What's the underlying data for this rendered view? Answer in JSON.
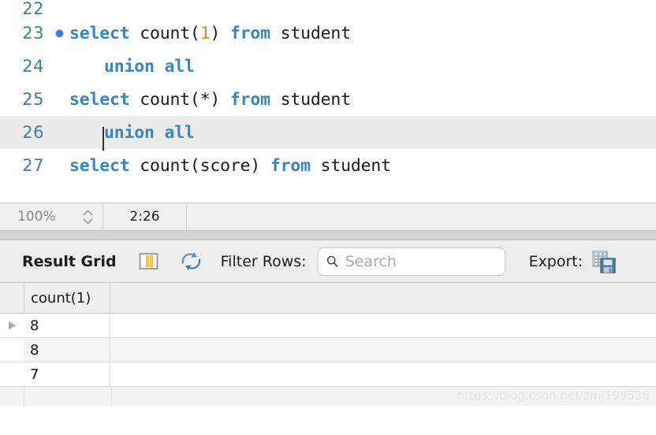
{
  "editor": {
    "lines": [
      {
        "number": "22",
        "breakpoint": false,
        "current": false,
        "indent": 0,
        "tokens": []
      },
      {
        "number": "23",
        "breakpoint": true,
        "current": false,
        "indent": 0,
        "tokens": [
          {
            "t": "select",
            "k": "kw"
          },
          {
            "t": " count(",
            "k": ""
          },
          {
            "t": "1",
            "k": "num"
          },
          {
            "t": ") ",
            "k": ""
          },
          {
            "t": "from",
            "k": "kw"
          },
          {
            "t": " student",
            "k": ""
          }
        ]
      },
      {
        "number": "24",
        "breakpoint": false,
        "current": false,
        "indent": 1,
        "tokens": [
          {
            "t": "union all",
            "k": "kw"
          }
        ]
      },
      {
        "number": "25",
        "breakpoint": false,
        "current": false,
        "indent": 0,
        "tokens": [
          {
            "t": "select",
            "k": "kw"
          },
          {
            "t": " count(*) ",
            "k": ""
          },
          {
            "t": "from",
            "k": "kw"
          },
          {
            "t": " student",
            "k": ""
          }
        ]
      },
      {
        "number": "26",
        "breakpoint": false,
        "current": true,
        "indent": 1,
        "tokens": [
          {
            "t": "union all",
            "k": "kw"
          }
        ]
      },
      {
        "number": "27",
        "breakpoint": false,
        "current": false,
        "indent": 0,
        "tokens": [
          {
            "t": "select",
            "k": "kw"
          },
          {
            "t": " count(score) ",
            "k": ""
          },
          {
            "t": "from",
            "k": "kw"
          },
          {
            "t": " student",
            "k": ""
          }
        ]
      }
    ]
  },
  "statusbar": {
    "zoom": "100%",
    "cursor_position": "2:26"
  },
  "result_grid": {
    "title": "Result Grid",
    "grid_icon_name": "columns-grid-icon",
    "refresh_icon_name": "refresh-icon",
    "filter_label": "Filter Rows:",
    "search_placeholder": "Search",
    "search_value": "",
    "search_icon_name": "search-icon",
    "export_label": "Export:",
    "export_icon_name": "export-grid-save-icon",
    "columns": [
      "count(1)"
    ],
    "rows": [
      {
        "values": [
          "8"
        ],
        "selected": true
      },
      {
        "values": [
          "8"
        ],
        "selected": false
      },
      {
        "values": [
          "7"
        ],
        "selected": false
      }
    ]
  },
  "watermark": "https://blog.csdn.net/zmj199536",
  "colors": {
    "keyword": "#3a87c0",
    "number_literal": "#d98c16",
    "line_number": "#3f7e9c",
    "breakpoint": "#3b82d6",
    "current_line_bg": "#ebebeb"
  }
}
